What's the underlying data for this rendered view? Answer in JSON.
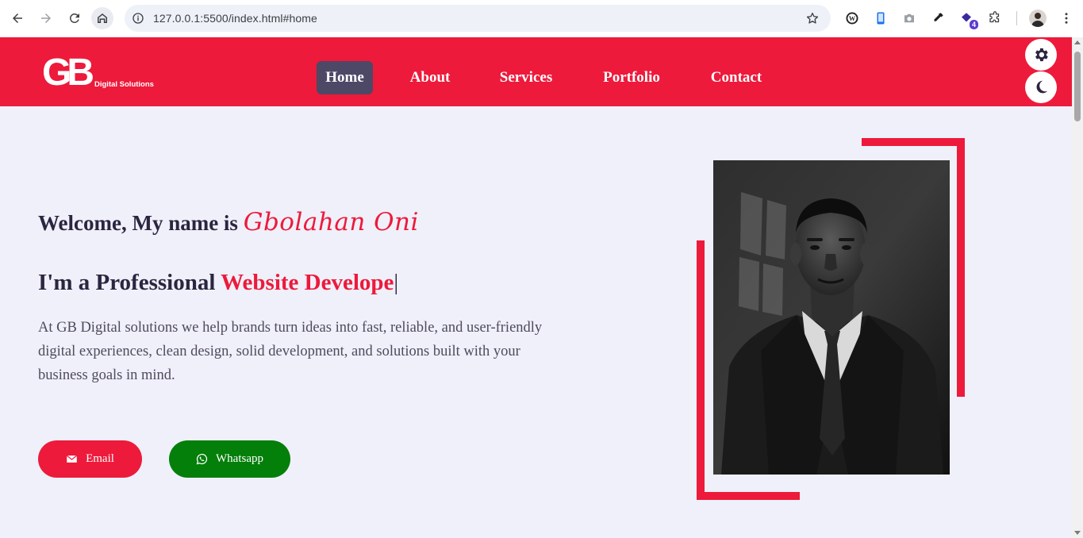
{
  "browser": {
    "url": "127.0.0.1:5500/index.html#home",
    "extensions": [
      {
        "name": "wordpress-icon"
      },
      {
        "name": "phone-emulator-icon"
      },
      {
        "name": "camera-icon"
      },
      {
        "name": "eyedropper-icon"
      },
      {
        "name": "extension-badge-icon",
        "badge": "4"
      },
      {
        "name": "puzzle-icon"
      }
    ]
  },
  "header": {
    "logo_mark": "GB",
    "logo_tagline": "Digital Solutions",
    "nav": [
      {
        "label": "Home",
        "active": true
      },
      {
        "label": "About",
        "active": false
      },
      {
        "label": "Services",
        "active": false
      },
      {
        "label": "Portfolio",
        "active": false
      },
      {
        "label": "Contact",
        "active": false
      }
    ],
    "accent_color": "#ed1a3b",
    "active_nav_color": "#4d4866"
  },
  "hero": {
    "welcome_prefix": "Welcome, My name is ",
    "name": "Gbolahan Oni",
    "profession_prefix": "I'm a Professional ",
    "profession_role": "Website Develope",
    "cursor": "|",
    "intro": "At GB Digital solutions we help brands turn ideas into fast, reliable, and user-friendly digital experiences, clean design, solid development, and solutions built with your business goals in mind.",
    "buttons": {
      "email": "Email",
      "whatsapp": "Whatsapp"
    },
    "email_color": "#ed1a3b",
    "whatsapp_color": "#047f0a"
  }
}
